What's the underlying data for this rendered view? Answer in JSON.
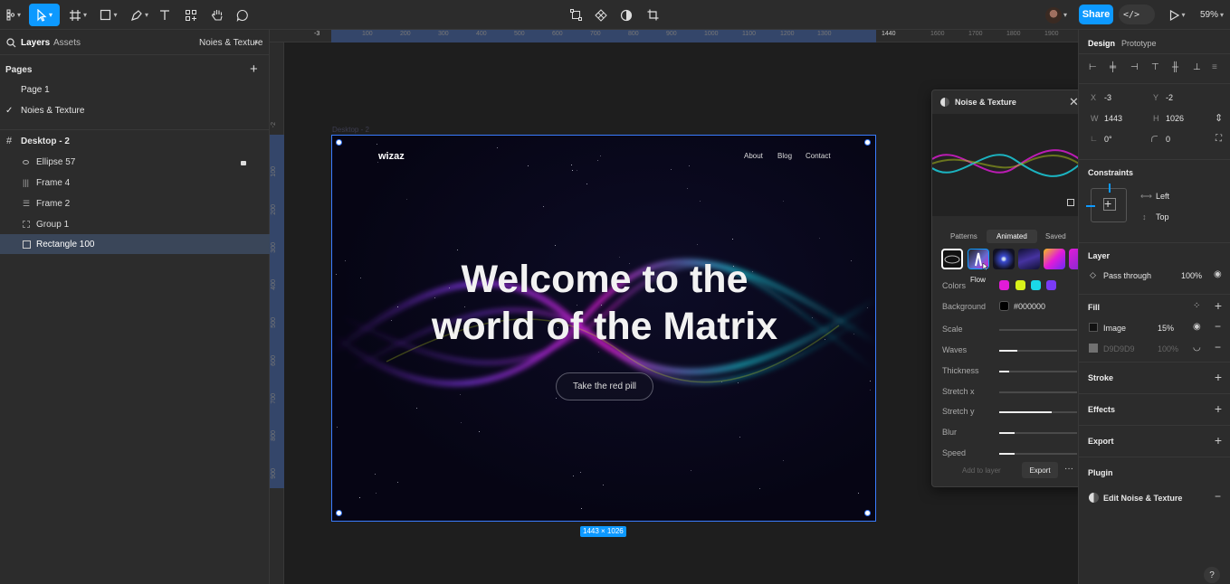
{
  "layers_panel": {
    "tab_layers": "Layers",
    "tab_assets": "Assets",
    "current_page": "Noies & Texture",
    "pages_title": "Pages",
    "pages": [
      {
        "label": "Page 1",
        "active": false
      },
      {
        "label": "Noies & Texture",
        "active": true
      }
    ],
    "frame_name": "Desktop - 2",
    "layers": [
      {
        "label": "Ellipse 57",
        "icon": "ellipse-icon",
        "locked": true
      },
      {
        "label": "Frame 4",
        "icon": "frame-columns-icon",
        "locked": false
      },
      {
        "label": "Frame 2",
        "icon": "frame-rows-icon",
        "locked": false
      },
      {
        "label": "Group 1",
        "icon": "group-icon",
        "locked": false
      },
      {
        "label": "Rectangle 100",
        "icon": "image-icon",
        "locked": false,
        "selected": true
      }
    ]
  },
  "ruler": {
    "top_ticks": [
      "-3",
      "100",
      "200",
      "300",
      "400",
      "500",
      "600",
      "700",
      "800",
      "900",
      "1000",
      "1100",
      "1200",
      "1300",
      "1440",
      "1600",
      "1700",
      "1800",
      "1900"
    ],
    "left_ticks": [
      "-2",
      "100",
      "200",
      "300",
      "400",
      "500",
      "600",
      "700",
      "800",
      "900"
    ]
  },
  "canvas": {
    "frame_label": "Desktop - 2",
    "size_badge": "1443 × 1026",
    "site": {
      "logo": "wizaz",
      "nav": [
        "About",
        "Blog",
        "Contact"
      ],
      "headline_1": "Welcome to the",
      "headline_2": "world of the Matrix",
      "cta": "Take the red pill"
    }
  },
  "plugin": {
    "title": "Noise & Texture",
    "tabs": [
      "Patterns",
      "Animated",
      "Saved"
    ],
    "active_tab": "Animated",
    "tooltip": "Flow",
    "colors_label": "Colors",
    "colors": [
      "#e21bd8",
      "#d8f21a",
      "#1ad8e8",
      "#7a3bf5"
    ],
    "background_label": "Background",
    "background_value": "#000000",
    "sliders": [
      {
        "label": "Scale",
        "value": 0.0
      },
      {
        "label": "Waves",
        "value": 0.23
      },
      {
        "label": "Thickness",
        "value": 0.13
      },
      {
        "label": "Stretch x",
        "value": 0.0
      },
      {
        "label": "Stretch y",
        "value": 0.67
      },
      {
        "label": "Blur",
        "value": 0.2
      },
      {
        "label": "Speed",
        "value": 0.2
      }
    ],
    "add_to_layer": "Add to layer",
    "export": "Export",
    "more": "···"
  },
  "design_panel": {
    "tab_design": "Design",
    "tab_prototype": "Prototype",
    "x_label": "X",
    "x_value": "-3",
    "y_label": "Y",
    "y_value": "-2",
    "w_label": "W",
    "w_value": "1443",
    "h_label": "H",
    "h_value": "1026",
    "rotation_value": "0°",
    "radius_value": "0",
    "constraints_title": "Constraints",
    "constraint_h": "Left",
    "constraint_v": "Top",
    "layer_title": "Layer",
    "blend_mode": "Pass through",
    "opacity": "100%",
    "fill_title": "Fill",
    "fills": [
      {
        "label": "Image",
        "value": "15%",
        "swatch": "#111111",
        "dim": false
      },
      {
        "label": "D9D9D9",
        "value": "100%",
        "swatch": "#d9d9d9",
        "dim": true
      }
    ],
    "stroke_title": "Stroke",
    "effects_title": "Effects",
    "export_title": "Export",
    "plugin_title": "Plugin",
    "plugin_item": "Edit Noise & Texture"
  },
  "toolbar": {
    "share": "Share",
    "zoom": "59%"
  },
  "colors": {
    "accent": "#0d99ff",
    "selection": "#3a7cff",
    "panel": "#2c2c2c",
    "canvas": "#1e1e1e"
  }
}
